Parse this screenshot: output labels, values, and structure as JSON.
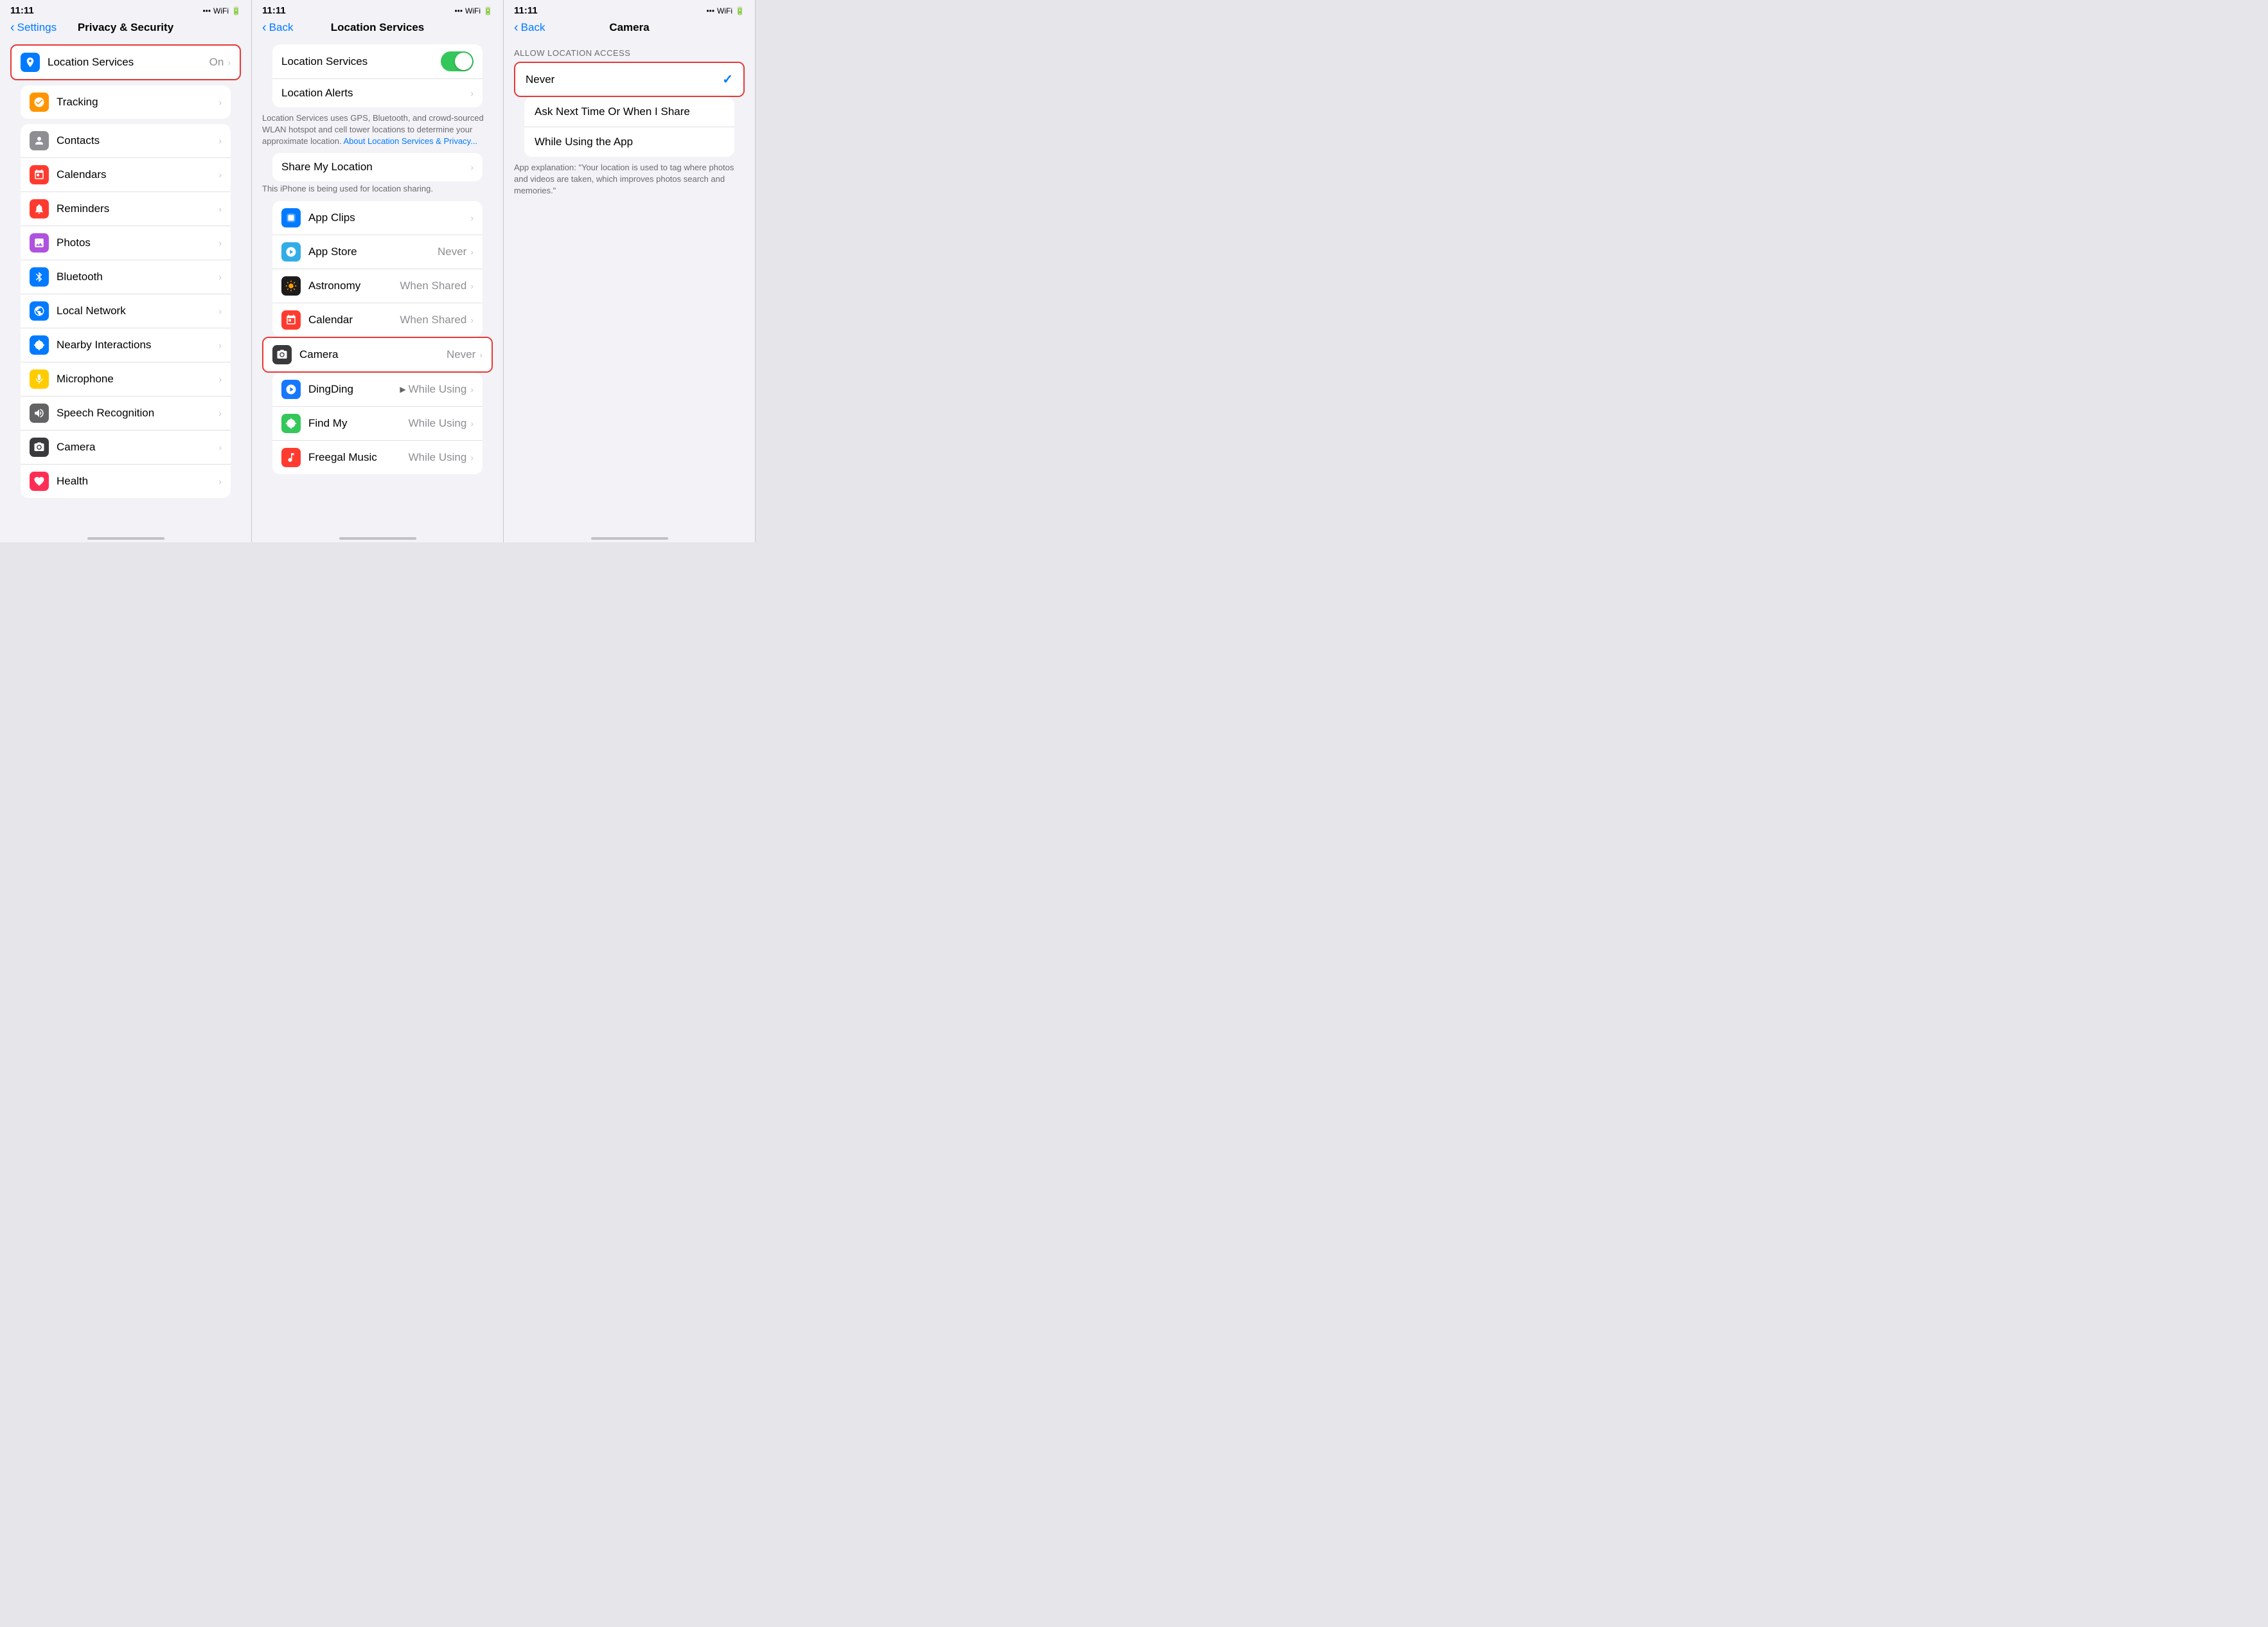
{
  "panel1": {
    "status_time": "11:11",
    "nav_back": "Settings",
    "nav_title": "Privacy & Security",
    "highlighted_item": {
      "label": "Location Services",
      "value": "On"
    },
    "items": [
      {
        "name": "tracking",
        "label": "Tracking",
        "icon_color": "icon-orange",
        "icon": "🔍",
        "value": ""
      },
      {
        "name": "contacts",
        "label": "Contacts",
        "icon_color": "icon-gray",
        "icon": "👤",
        "value": ""
      },
      {
        "name": "calendars",
        "label": "Calendars",
        "icon_color": "icon-red",
        "icon": "📅",
        "value": ""
      },
      {
        "name": "reminders",
        "label": "Reminders",
        "icon_color": "icon-red",
        "icon": "☑",
        "value": ""
      },
      {
        "name": "photos",
        "label": "Photos",
        "icon_color": "icon-purple",
        "icon": "🌈",
        "value": ""
      },
      {
        "name": "bluetooth",
        "label": "Bluetooth",
        "icon_color": "icon-blue",
        "icon": "B",
        "value": ""
      },
      {
        "name": "local-network",
        "label": "Local Network",
        "icon_color": "icon-blue",
        "icon": "🌐",
        "value": ""
      },
      {
        "name": "nearby-interactions",
        "label": "Nearby Interactions",
        "icon_color": "icon-blue",
        "icon": "◎",
        "value": ""
      },
      {
        "name": "microphone",
        "label": "Microphone",
        "icon_color": "icon-yellow",
        "icon": "🎤",
        "value": ""
      },
      {
        "name": "speech-recognition",
        "label": "Speech Recognition",
        "icon_color": "icon-gray",
        "icon": "〰",
        "value": ""
      },
      {
        "name": "camera",
        "label": "Camera",
        "icon_color": "icon-darkgray",
        "icon": "📷",
        "value": ""
      },
      {
        "name": "health",
        "label": "Health",
        "icon_color": "icon-pink",
        "icon": "♥",
        "value": ""
      }
    ]
  },
  "panel2": {
    "status_time": "11:11",
    "nav_back": "Back",
    "nav_title": "Location Services",
    "toggle_on": true,
    "location_services_label": "Location Services",
    "location_alerts_label": "Location Alerts",
    "description": "Location Services uses GPS, Bluetooth, and crowd-sourced WLAN hotspot and cell tower locations to determine your approximate location.",
    "about_link": "About Location Services & Privacy...",
    "share_my_location_label": "Share My Location",
    "sharing_desc": "This iPhone is being used for location sharing.",
    "apps": [
      {
        "name": "app-clips",
        "label": "App Clips",
        "icon_color": "icon-blue",
        "icon": "◻",
        "value": ""
      },
      {
        "name": "app-store",
        "label": "App Store",
        "icon_color": "icon-lightblue",
        "icon": "A",
        "value": "Never"
      },
      {
        "name": "astronomy",
        "label": "Astronomy",
        "icon_color": "icon-darkgray",
        "icon": "⊙",
        "value": "When Shared"
      },
      {
        "name": "calendar",
        "label": "Calendar",
        "icon_color": "icon-red",
        "icon": "📅",
        "value": "When Shared"
      },
      {
        "name": "camera",
        "label": "Camera",
        "icon_color": "icon-darkgray",
        "icon": "📷",
        "value": "Never",
        "highlighted": true
      },
      {
        "name": "dingding",
        "label": "DingDing",
        "icon_color": "icon-blue",
        "icon": "▸",
        "value": "While Using",
        "has_loc_icon": true
      },
      {
        "name": "find-my",
        "label": "Find My",
        "icon_color": "icon-green",
        "icon": "◎",
        "value": "While Using"
      },
      {
        "name": "freegal-music",
        "label": "Freegal Music",
        "icon_color": "icon-red",
        "icon": "F",
        "value": "While Using"
      }
    ]
  },
  "panel3": {
    "status_time": "11:11",
    "nav_back": "Back",
    "nav_title": "Camera",
    "section_label": "ALLOW LOCATION ACCESS",
    "options": [
      {
        "name": "never",
        "label": "Never",
        "selected": true,
        "highlighted": true
      },
      {
        "name": "ask-next-time",
        "label": "Ask Next Time Or When I Share",
        "selected": false
      },
      {
        "name": "while-using",
        "label": "While Using the App",
        "selected": false
      }
    ],
    "explanation_label": "App explanation:",
    "explanation_text": "\"Your location is used to tag where photos and videos are taken, which improves photos search and memories.\""
  },
  "icons": {
    "wifi": "▾",
    "battery": "🔋",
    "signal": "•••"
  }
}
